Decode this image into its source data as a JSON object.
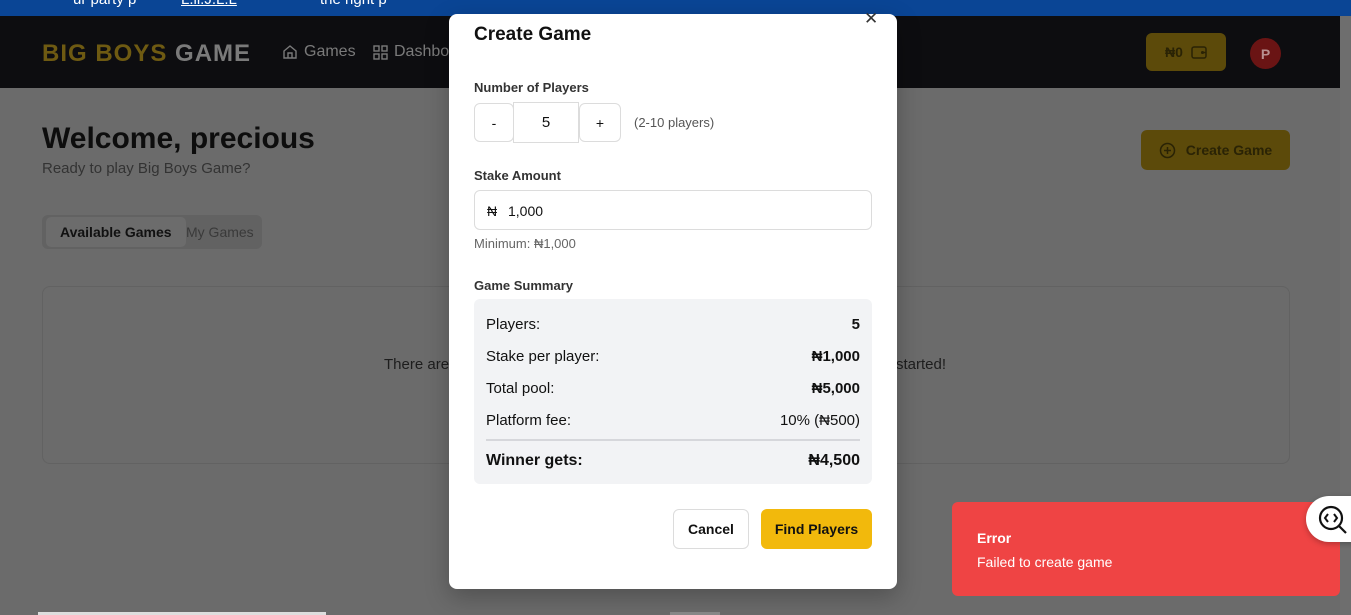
{
  "top_strip": {
    "text_a": "ur party p",
    "link": "L.ll.J.L.L",
    "text_b": "the right p"
  },
  "header": {
    "logo_part1": "BIG BOYS",
    "logo_part2": "GAME",
    "nav": [
      {
        "label": "Games",
        "icon": "home-icon"
      },
      {
        "label": "Dashboa",
        "icon": "dashboard-icon"
      }
    ],
    "wallet_balance": "₦0",
    "avatar_initial": "P"
  },
  "page": {
    "welcome": "Welcome, precious",
    "subtitle": "Ready to play Big Boys Game?",
    "create_game_label": "Create Game",
    "tabs": [
      "Available Games",
      "My Games"
    ],
    "empty_left": "There are",
    "empty_right": "started!"
  },
  "modal": {
    "title": "Create Game",
    "close_icon": "close-icon",
    "players_label": "Number of Players",
    "decrement": "-",
    "players_value": "5",
    "increment": "+",
    "players_hint": "(2-10 players)",
    "stake_label": "Stake Amount",
    "currency_symbol": "₦",
    "stake_value": "1,000",
    "stake_minimum": "Minimum: ₦1,000",
    "summary_label": "Game Summary",
    "summary": {
      "players_label": "Players:",
      "players_value": "5",
      "stake_label": "Stake per player:",
      "stake_value": "₦1,000",
      "pool_label": "Total pool:",
      "pool_value": "₦5,000",
      "fee_label": "Platform fee:",
      "fee_value": "10% (₦500)",
      "winner_label": "Winner gets:",
      "winner_value": "₦4,500"
    },
    "cancel_label": "Cancel",
    "find_label": "Find Players"
  },
  "toast": {
    "title": "Error",
    "description": "Failed to create game",
    "color": "#ef4444"
  },
  "colors": {
    "accent": "#f2b90c",
    "header_bg": "#0d0d10",
    "top_strip": "#0a4595"
  }
}
